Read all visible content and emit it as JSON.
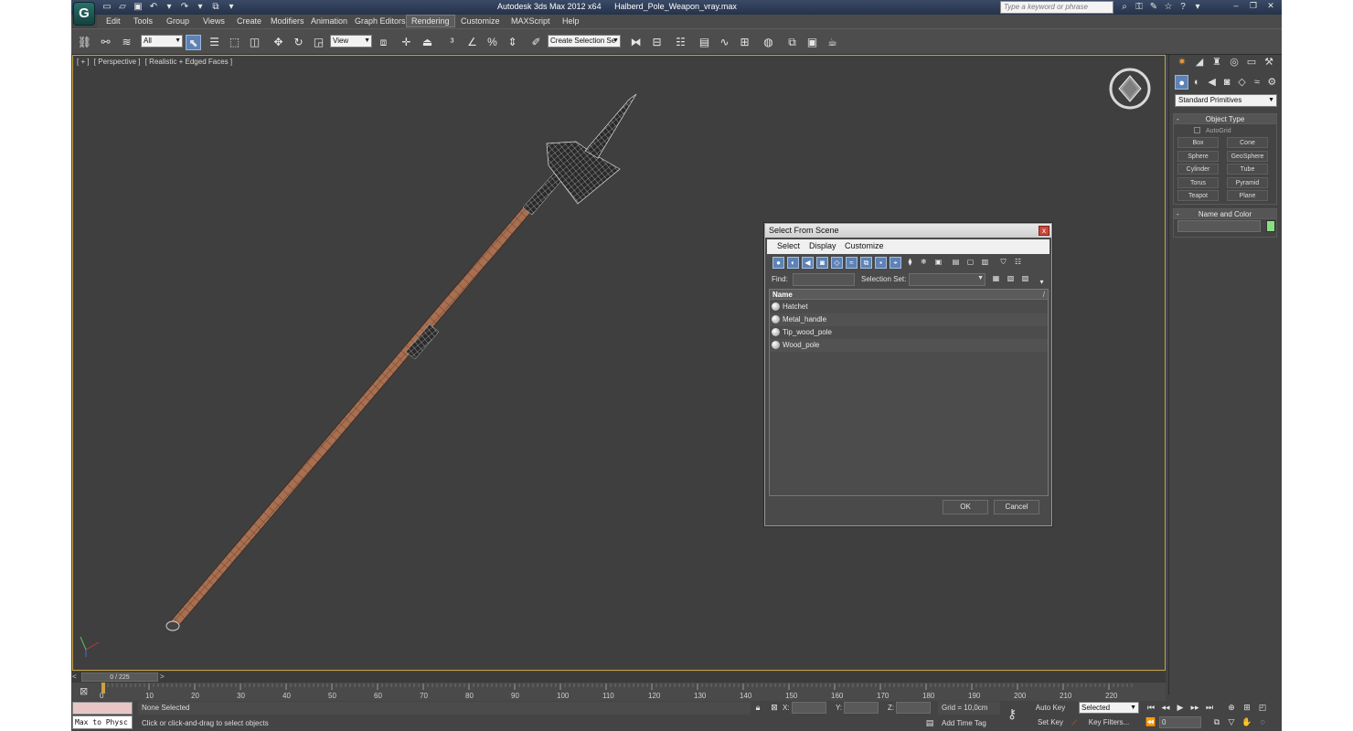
{
  "window": {
    "app_name": "Autodesk 3ds Max  2012 x64",
    "file_name": "Halberd_Pole_Weapon_vray.max",
    "search_placeholder": "Type a keyword or phrase",
    "logo_letter": "G"
  },
  "menu": [
    "Edit",
    "Tools",
    "Group",
    "Views",
    "Create",
    "Modifiers",
    "Animation",
    "Graph Editors",
    "Rendering",
    "Customize",
    "MAXScript",
    "Help"
  ],
  "toolbar": {
    "selection_filter": "All",
    "ref_coord": "View",
    "named_selection": "Create Selection Se"
  },
  "viewport": {
    "label_parts": [
      "[ + ]",
      "[ Perspective ]",
      "[ Realistic + Edged Faces ]"
    ]
  },
  "command_panel": {
    "category": "Standard Primitives",
    "object_type_title": "Object Type",
    "autogrid": "AutoGrid",
    "primitives": [
      "Box",
      "Cone",
      "Sphere",
      "GeoSphere",
      "Cylinder",
      "Tube",
      "Torus",
      "Pyramid",
      "Teapot",
      "Plane"
    ],
    "name_color_title": "Name and Color",
    "color": "#86e07e"
  },
  "timeline": {
    "frame_display": "0 / 225",
    "ticks": [
      0,
      10,
      20,
      30,
      40,
      50,
      60,
      70,
      80,
      90,
      100,
      110,
      120,
      130,
      140,
      150,
      160,
      170,
      180,
      190,
      200,
      210,
      220
    ]
  },
  "status": {
    "maxscript": "Max to Physc",
    "selection": "None Selected",
    "prompt": "Click or click-and-drag to select objects",
    "x_label": "X:",
    "y_label": "Y:",
    "z_label": "Z:",
    "grid": "Grid = 10,0cm",
    "add_time_tag": "Add Time Tag",
    "auto_key": "Auto Key",
    "set_key": "Set Key",
    "key_mode": "Selected",
    "key_filters": "Key Filters...",
    "current_frame": "0"
  },
  "dialog": {
    "title": "Select From Scene",
    "close": "x",
    "menu": [
      "Select",
      "Display",
      "Customize"
    ],
    "find_label": "Find:",
    "selection_set_label": "Selection Set:",
    "column_name": "Name",
    "sort_indicator": "/",
    "objects": [
      "Hatchet",
      "Metal_handle",
      "Tip_wood_pole",
      "Wood_pole"
    ],
    "ok": "OK",
    "cancel": "Cancel"
  }
}
